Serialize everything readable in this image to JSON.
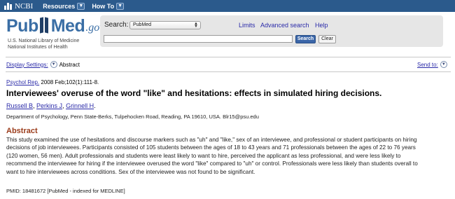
{
  "topbar": {
    "brand": "NCBI",
    "menus": [
      {
        "label": "Resources"
      },
      {
        "label": "How To"
      }
    ]
  },
  "header": {
    "logo": {
      "pub": "Pub",
      "med": "Med",
      "gov": ".gov"
    },
    "nlm_line1": "U.S. National Library of Medicine",
    "nlm_line2": "National Institutes of Health",
    "search_label": "Search:",
    "database_selected": "PubMed",
    "links": {
      "limits": "Limits",
      "advanced": "Advanced search",
      "help": "Help"
    },
    "search_value": "",
    "search_button": "Search",
    "clear_button": "Clear"
  },
  "display": {
    "settings_label": "Display Settings:",
    "format": "Abstract",
    "send_to": "Send to:"
  },
  "article": {
    "journal": "Psychol Rep.",
    "citation_rest": " 2008 Feb;102(1):111-8.",
    "title": "Interviewees' overuse of the word \"like\" and hesitations: effects in simulated hiring decisions.",
    "authors": [
      "Russell B",
      "Perkins J",
      "Grinnell H"
    ],
    "affiliation": "Department of Psychology, Penn State-Berks, Tulpehocken Road, Reading, PA 19610, USA. Blr15@psu.edu",
    "abstract_heading": "Abstract",
    "abstract_lines": [
      "This study examined the use of hesitations and discourse markers such as \"uh\" and \"like,\" sex of an interviewee, and professional or student participants on hiring",
      "decisions of job interviewees. Participants consisted of 105 students between the ages of 18 to 43 years and 71 professionals between the ages of 22 to 76 years",
      "(120 women, 56 men). Adult professionals and students were least likely to want to hire, perceived the applicant as less professional, and were less likely to",
      "recommend the interviewee for hiring if the interviewee overused the word \"like\" compared to \"uh\" or control. Professionals were less likely than students overall to",
      "want to hire interviewees across conditions. Sex of the interviewee was not found to be significant."
    ],
    "pmid": "PMID: 18481672 [PubMed - indexed for MEDLINE]"
  },
  "colors": {
    "topbar": "#2b5a8c",
    "logo_blue": "#3a6ea5",
    "link": "#2a2aa8",
    "abstract_heading": "#9a3b1a",
    "search_button": "#3b66a8"
  },
  "icons": {
    "dropdown": "chevron-down-icon",
    "select": "up-down-arrows-icon"
  }
}
